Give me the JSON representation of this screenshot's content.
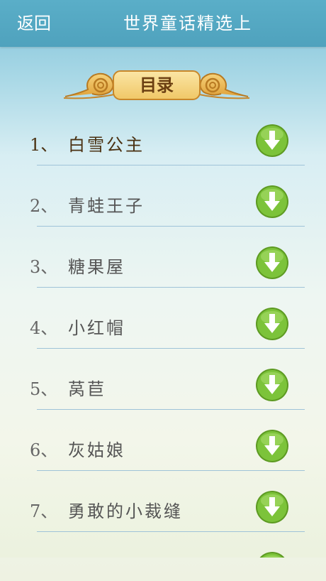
{
  "header": {
    "back_label": "返回",
    "title": "世界童话精选上"
  },
  "badge": {
    "label": "目录"
  },
  "stories": [
    {
      "num": "1、",
      "title": "白雪公主"
    },
    {
      "num": "2、",
      "title": "青蛙王子"
    },
    {
      "num": "3、",
      "title": "糖果屋"
    },
    {
      "num": "4、",
      "title": "小红帽"
    },
    {
      "num": "5、",
      "title": "莴苣"
    },
    {
      "num": "6、",
      "title": "灰姑娘"
    },
    {
      "num": "7、",
      "title": "勇敢的小裁缝"
    },
    {
      "num": "",
      "title": ""
    }
  ],
  "colors": {
    "header": "#5aaec8",
    "download_button": "#7cc33a",
    "divider": "#9fc3d8"
  },
  "icons": {
    "download": "download-arrow-icon"
  }
}
